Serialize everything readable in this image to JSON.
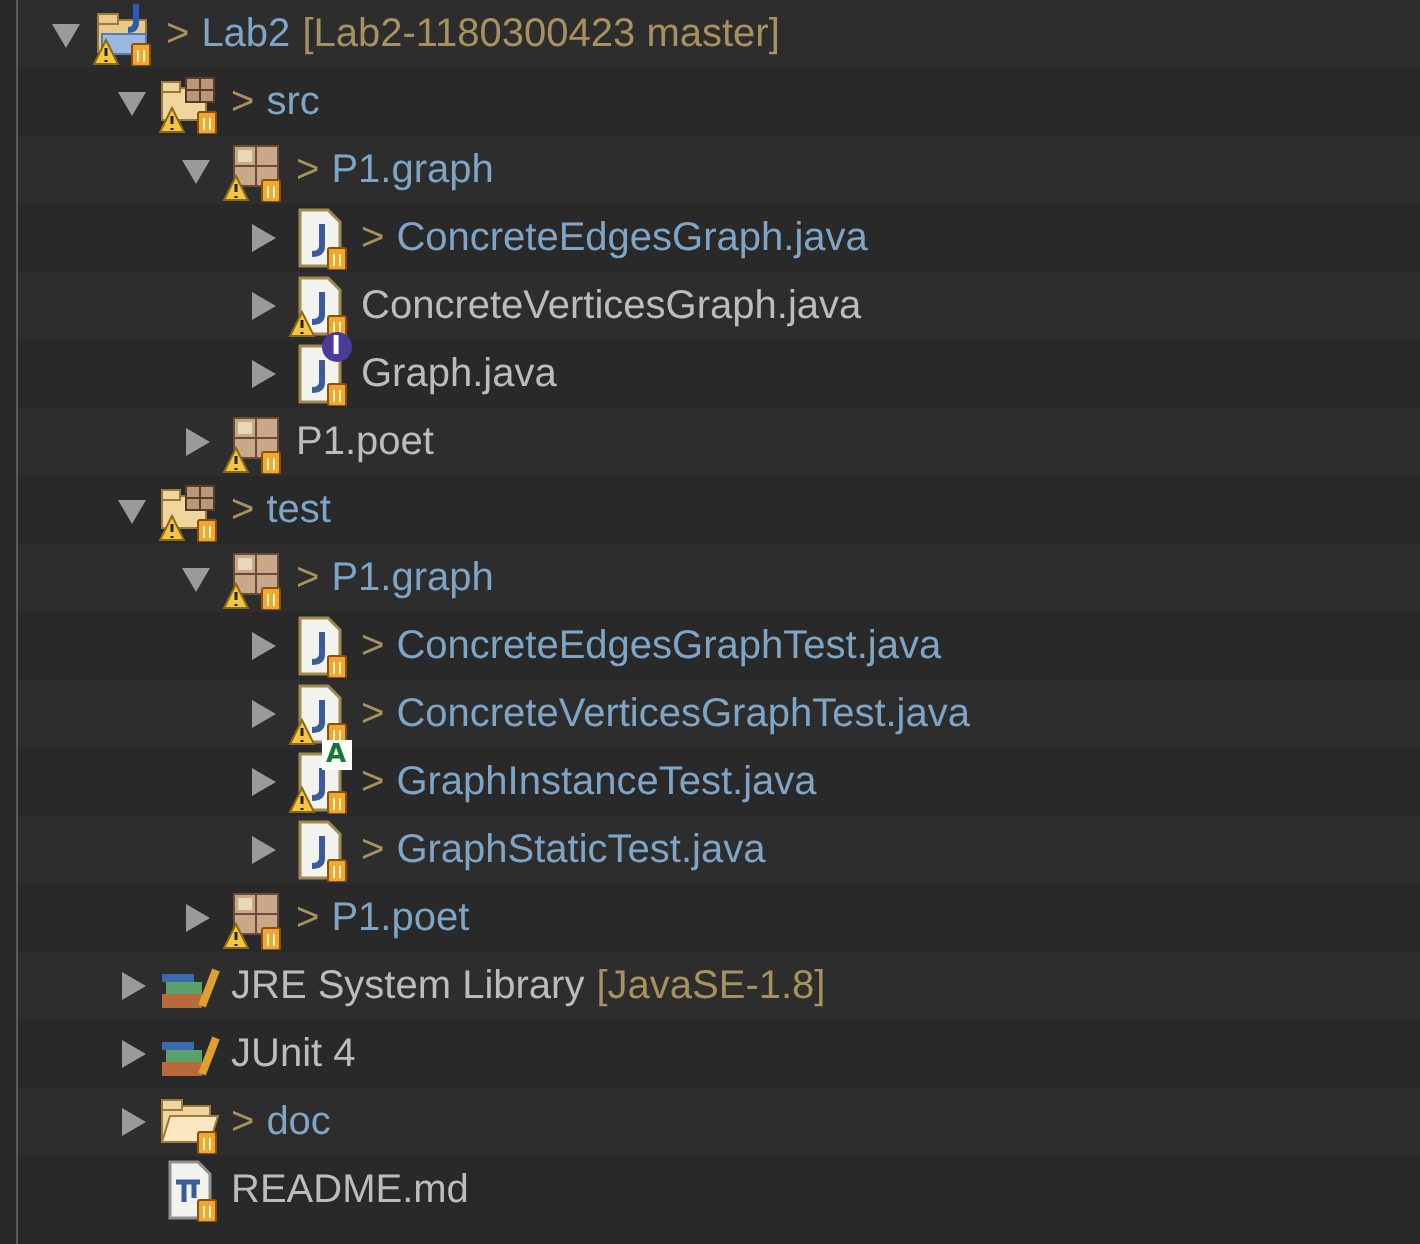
{
  "tree": [
    {
      "label": "Lab2",
      "kind": "project",
      "dirty_mark": ">",
      "decoration": "[Lab2-1180300423 master]",
      "expanded": true,
      "warning": true,
      "tracked": true,
      "children": [
        {
          "label": "src",
          "kind": "source-folder",
          "dirty_mark": ">",
          "expanded": true,
          "warning": true,
          "tracked": true,
          "children": [
            {
              "label": "P1.graph",
              "kind": "package",
              "dirty_mark": ">",
              "expanded": true,
              "warning": true,
              "tracked": true,
              "children": [
                {
                  "label": "ConcreteEdgesGraph.java",
                  "kind": "java-file",
                  "dirty_mark": ">",
                  "expanded": false,
                  "warning": false,
                  "tracked": true
                },
                {
                  "label": "ConcreteVerticesGraph.java",
                  "kind": "java-file",
                  "expanded": false,
                  "warning": true,
                  "tracked": true
                },
                {
                  "label": "Graph.java",
                  "kind": "java-file",
                  "badge": {
                    "text": "I",
                    "kind": "interface"
                  },
                  "expanded": false,
                  "warning": false,
                  "tracked": true
                }
              ]
            },
            {
              "label": "P1.poet",
              "kind": "package",
              "expanded": false,
              "warning": true,
              "tracked": true
            }
          ]
        },
        {
          "label": "test",
          "kind": "source-folder",
          "dirty_mark": ">",
          "expanded": true,
          "warning": true,
          "tracked": true,
          "children": [
            {
              "label": "P1.graph",
              "kind": "package",
              "dirty_mark": ">",
              "expanded": true,
              "warning": true,
              "tracked": true,
              "children": [
                {
                  "label": "ConcreteEdgesGraphTest.java",
                  "kind": "java-file",
                  "dirty_mark": ">",
                  "expanded": false,
                  "warning": false,
                  "tracked": true
                },
                {
                  "label": "ConcreteVerticesGraphTest.java",
                  "kind": "java-file",
                  "dirty_mark": ">",
                  "expanded": false,
                  "warning": true,
                  "tracked": true
                },
                {
                  "label": "GraphInstanceTest.java",
                  "kind": "java-file",
                  "badge": {
                    "text": "A",
                    "kind": "abstract"
                  },
                  "dirty_mark": ">",
                  "expanded": false,
                  "warning": true,
                  "tracked": true
                },
                {
                  "label": "GraphStaticTest.java",
                  "kind": "java-file",
                  "dirty_mark": ">",
                  "expanded": false,
                  "warning": false,
                  "tracked": true
                }
              ]
            },
            {
              "label": "P1.poet",
              "kind": "package",
              "dirty_mark": ">",
              "expanded": false,
              "warning": true,
              "tracked": true
            }
          ]
        },
        {
          "label": "JRE System Library",
          "kind": "library",
          "decoration": "[JavaSE-1.8]",
          "expanded": false,
          "warning": false,
          "tracked": false
        },
        {
          "label": "JUnit 4",
          "kind": "library",
          "expanded": false,
          "warning": false,
          "tracked": false
        },
        {
          "label": "doc",
          "kind": "folder",
          "dirty_mark": ">",
          "expanded": false,
          "warning": false,
          "tracked": true
        },
        {
          "label": "README.md",
          "kind": "markdown-file",
          "warning": false,
          "tracked": true
        }
      ]
    }
  ]
}
